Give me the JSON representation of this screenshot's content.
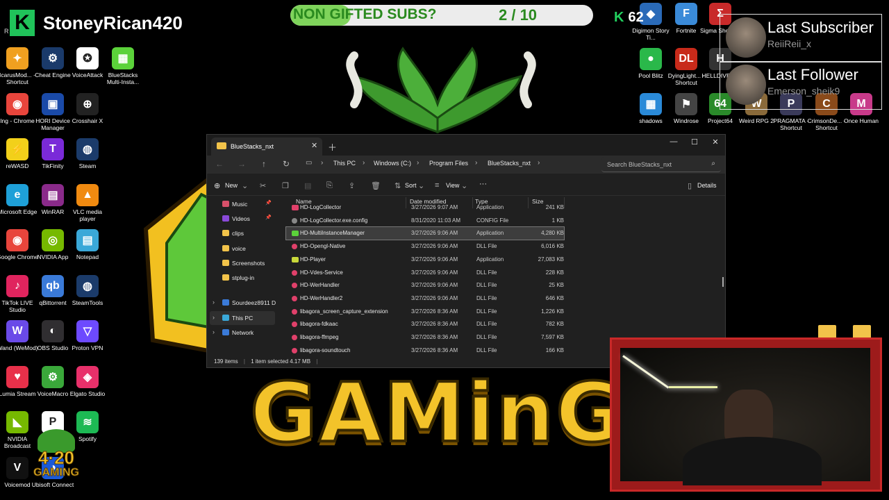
{
  "overlay": {
    "brand_logo": "K",
    "brand_name": "StoneyRican420",
    "brand_r": "R",
    "subs_goal_label": "NON GIFTED SUBS?",
    "subs_goal_count": "2 / 10",
    "subs_goal_fraction": 0.2,
    "kick_icon": "K",
    "kick_followers": "62",
    "last_subscriber_title": "Last Subscriber",
    "last_subscriber_name": "ReiiReii_x",
    "last_follower_title": "Last Follower",
    "last_follower_name": "Emerson_sheik9",
    "gaming_word": "GAMinG"
  },
  "desktop_left": [
    {
      "label": "IcarusMod... - Shortcut",
      "icon": "icarus-icon",
      "color": "#f0a020",
      "glyph": "✦"
    },
    {
      "label": "Cheat Engine",
      "icon": "cheat-engine-icon",
      "color": "#1a3a6a",
      "glyph": "⚙"
    },
    {
      "label": "VoiceAttack",
      "icon": "voiceattack-icon",
      "color": "#ffffff",
      "glyph": "✪"
    },
    {
      "label": "BlueStacks Multi-Insta...",
      "icon": "bluestacks-icon",
      "color": "#5bd23a",
      "glyph": "▦"
    },
    {
      "label": "Ing - Chrome",
      "icon": "chrome-icon",
      "color": "#e8453c",
      "glyph": "◉"
    },
    {
      "label": "HORI Device Manager",
      "icon": "hori-icon",
      "color": "#1a4aa8",
      "glyph": "▣"
    },
    {
      "label": "Crosshair X",
      "icon": "crosshair-icon",
      "color": "#222222",
      "glyph": "⊕"
    },
    {
      "label": "reWASD",
      "icon": "rewasd-icon",
      "color": "#f2d01a",
      "glyph": "⚡"
    },
    {
      "label": "TikFinity",
      "icon": "tikfinity-icon",
      "color": "#7a2ad8",
      "glyph": "T"
    },
    {
      "label": "Steam",
      "icon": "steam-icon",
      "color": "#1b3b6a",
      "glyph": "◍"
    },
    {
      "label": "Microsoft Edge",
      "icon": "edge-icon",
      "color": "#1ea0d8",
      "glyph": "e"
    },
    {
      "label": "WinRAR",
      "icon": "winrar-icon",
      "color": "#8a2a8a",
      "glyph": "▤"
    },
    {
      "label": "VLC media player",
      "icon": "vlc-icon",
      "color": "#f08a10",
      "glyph": "▲"
    },
    {
      "label": "Google Chrome",
      "icon": "chrome-icon",
      "color": "#e8453c",
      "glyph": "◉"
    },
    {
      "label": "NVIDIA App",
      "icon": "nvidia-icon",
      "color": "#76b900",
      "glyph": "◎"
    },
    {
      "label": "Notepad",
      "icon": "notepad-icon",
      "color": "#3aa8d8",
      "glyph": "▤"
    },
    {
      "label": "TikTok LIVE Studio",
      "icon": "tiktok-icon",
      "color": "#e0245e",
      "glyph": "♪"
    },
    {
      "label": "qBittorrent",
      "icon": "qbittorrent-icon",
      "color": "#3a7ad8",
      "glyph": "qb"
    },
    {
      "label": "SteamTools",
      "icon": "steamtools-icon",
      "color": "#1b3b6a",
      "glyph": "◍"
    },
    {
      "label": "Wand (WeMod)",
      "icon": "wand-icon",
      "color": "#6a4ae8",
      "glyph": "W"
    },
    {
      "label": "OBS Studio",
      "icon": "obs-icon",
      "color": "#302e31",
      "glyph": "◐"
    },
    {
      "label": "Proton VPN",
      "icon": "protonvpn-icon",
      "color": "#6d4aff",
      "glyph": "▽"
    },
    {
      "label": "Lumia Stream",
      "icon": "lumia-icon",
      "color": "#e8304a",
      "glyph": "♥"
    },
    {
      "label": "VoiceMacro",
      "icon": "voicemacro-icon",
      "color": "#3aa83a",
      "glyph": "⚙"
    },
    {
      "label": "Elgato Studio",
      "icon": "elgato-icon",
      "color": "#e8306a",
      "glyph": "◈"
    },
    {
      "label": "NVIDIA Broadcast",
      "icon": "nvidia-broadcast-icon",
      "color": "#76b900",
      "glyph": "◣"
    },
    {
      "label": "",
      "icon": "uplay-icon",
      "color": "#ffffff",
      "glyph": "P"
    },
    {
      "label": "Spotify",
      "icon": "spotify-icon",
      "color": "#1db954",
      "glyph": "≋"
    },
    {
      "label": "Voicemod",
      "icon": "voicemod-icon",
      "color": "#111111",
      "glyph": "V"
    },
    {
      "label": "Ubisoft Connect",
      "icon": "ubisoft-icon",
      "color": "#1a5ad8",
      "glyph": "◕"
    }
  ],
  "desktop_right": [
    {
      "label": "Digimon Story Ti...",
      "icon": "digimon-icon",
      "color": "#2a6ab8",
      "glyph": "◆"
    },
    {
      "label": "Fortnite",
      "icon": "fortnite-icon",
      "color": "#3a8ad8",
      "glyph": "F"
    },
    {
      "label": "Sigma Shortcut",
      "icon": "sigma-icon",
      "color": "#c82a2a",
      "glyph": "Σ"
    },
    {
      "label": "Pool Blitz",
      "icon": "poolblitz-icon",
      "color": "#2ab84a",
      "glyph": "●"
    },
    {
      "label": "DyingLight... - Shortcut",
      "icon": "dyinglight-icon",
      "color": "#c82a1a",
      "glyph": "DL"
    },
    {
      "label": "HELLDIVERS",
      "icon": "helldivers-icon",
      "color": "#333333",
      "glyph": "H"
    },
    {
      "label": "shadows",
      "icon": "shadows-icon",
      "color": "#2a8ad8",
      "glyph": "▦"
    },
    {
      "label": "Windrose",
      "icon": "windrose-icon",
      "color": "#444444",
      "glyph": "⚑"
    },
    {
      "label": "Project64",
      "icon": "project64-icon",
      "color": "#2a8a2a",
      "glyph": "64"
    },
    {
      "label": "Weird RPG 2",
      "icon": "weirdrpg-icon",
      "color": "#8a6a3a",
      "glyph": "W"
    },
    {
      "label": "PRAGMATA - Shortcut",
      "icon": "pragmata-icon",
      "color": "#3a3a5a",
      "glyph": "P"
    },
    {
      "label": "CrimsonDe... - Shortcut",
      "icon": "crimson-icon",
      "color": "#8a4a1a",
      "glyph": "C"
    },
    {
      "label": "Once Human",
      "icon": "oncehuman-icon",
      "color": "#c83a8a",
      "glyph": "M"
    }
  ],
  "explorer": {
    "tab_title": "BlueStacks_nxt",
    "breadcrumb": [
      "This PC",
      "Windows (C:)",
      "Program Files",
      "BlueStacks_nxt"
    ],
    "search_placeholder": "Search BlueStacks_nxt",
    "cmd": {
      "new": "New",
      "sort": "Sort",
      "view": "View",
      "more": "···",
      "details": "Details"
    },
    "nav": [
      {
        "label": "Music",
        "color": "#d8506a",
        "pinned": true
      },
      {
        "label": "Videos",
        "color": "#8a4ad8",
        "pinned": true
      },
      {
        "label": "clips",
        "color": "#f2c34a",
        "pinned": false
      },
      {
        "label": "voice",
        "color": "#f2c34a",
        "pinned": false
      },
      {
        "label": "Screenshots",
        "color": "#f2c34a",
        "pinned": false
      },
      {
        "label": "stplug-in",
        "color": "#f2c34a",
        "pinned": false
      }
    ],
    "nav_tree": [
      {
        "label": "Sourdeez8911 D",
        "color": "#3a7ad8"
      },
      {
        "label": "This PC",
        "color": "#3aa8d8"
      },
      {
        "label": "Network",
        "color": "#3a7ad8"
      }
    ],
    "columns": [
      "Name",
      "Date modified",
      "Type",
      "Size"
    ],
    "files": [
      {
        "name": "HD-LogCollector",
        "date": "3/27/2026 9:07 AM",
        "type": "Application",
        "size": "241 KB",
        "color": "#e0406a"
      },
      {
        "name": "HD-LogCollector.exe.config",
        "date": "8/31/2020 11:03 AM",
        "type": "CONFIG File",
        "size": "1 KB",
        "color": "#888888"
      },
      {
        "name": "HD-MultiInstanceManager",
        "date": "3/27/2026 9:06 AM",
        "type": "Application",
        "size": "4,280 KB",
        "color": "#5bd23a"
      },
      {
        "name": "HD-Opengl-Native",
        "date": "3/27/2026 9:06 AM",
        "type": "DLL File",
        "size": "6,016 KB",
        "color": "#e0406a"
      },
      {
        "name": "HD-Player",
        "date": "3/27/2026 9:06 AM",
        "type": "Application",
        "size": "27,083 KB",
        "color": "#c8d83a"
      },
      {
        "name": "HD-Vdes-Service",
        "date": "3/27/2026 9:06 AM",
        "type": "DLL File",
        "size": "228 KB",
        "color": "#e0406a"
      },
      {
        "name": "HD-WerHandler",
        "date": "3/27/2026 9:06 AM",
        "type": "DLL File",
        "size": "25 KB",
        "color": "#e0406a"
      },
      {
        "name": "HD-WerHandler2",
        "date": "3/27/2026 9:06 AM",
        "type": "DLL File",
        "size": "646 KB",
        "color": "#e0406a"
      },
      {
        "name": "libagora_screen_capture_extension",
        "date": "3/27/2026 8:36 AM",
        "type": "DLL File",
        "size": "1,226 KB",
        "color": "#e0406a"
      },
      {
        "name": "libagora-fdkaac",
        "date": "3/27/2026 8:36 AM",
        "type": "DLL File",
        "size": "782 KB",
        "color": "#e0406a"
      },
      {
        "name": "libagora-ffmpeg",
        "date": "3/27/2026 8:36 AM",
        "type": "DLL File",
        "size": "7,597 KB",
        "color": "#e0406a"
      },
      {
        "name": "libagora-soundtouch",
        "date": "3/27/2026 8:36 AM",
        "type": "DLL File",
        "size": "166 KB",
        "color": "#e0406a"
      }
    ],
    "selected_index": 2,
    "status": {
      "items": "139 items",
      "selected": "1 item selected  4.17 MB"
    }
  },
  "logo420": {
    "top": "4·20",
    "bottom": "GAMING"
  }
}
